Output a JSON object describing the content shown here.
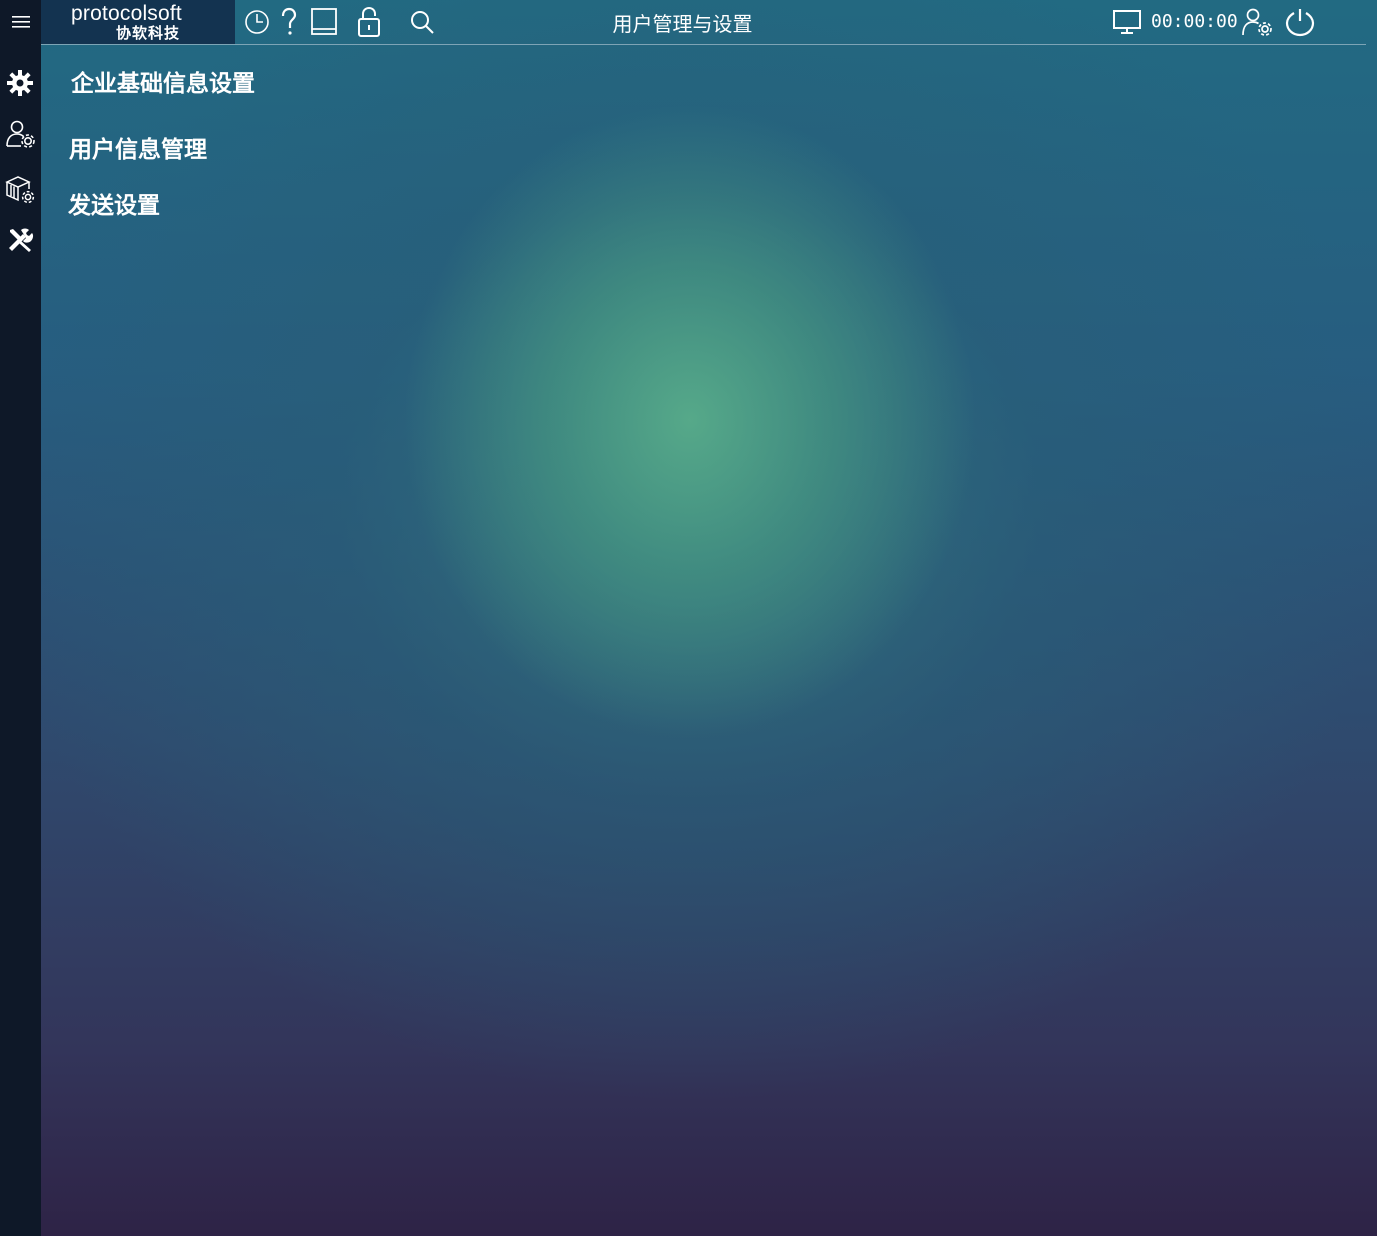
{
  "app": {
    "logo_text": "protocolsoft",
    "logo_subtext": "协软科技",
    "page_title": "用户管理与设置",
    "timer": "00:00:00"
  },
  "sidebar": {
    "icons": [
      "menu-icon",
      "gear-icon",
      "user-settings-icon",
      "package-settings-icon",
      "tools-icon"
    ]
  },
  "toolbar": {
    "icons": [
      "clock-icon",
      "help-icon",
      "tablet-icon",
      "lock-icon",
      "search-icon",
      "monitor-icon",
      "user-gear-icon",
      "power-icon"
    ]
  },
  "menu": {
    "items": [
      {
        "label": "企业基础信息设置"
      },
      {
        "label": "用户信息管理"
      },
      {
        "label": "发送设置"
      }
    ]
  }
}
